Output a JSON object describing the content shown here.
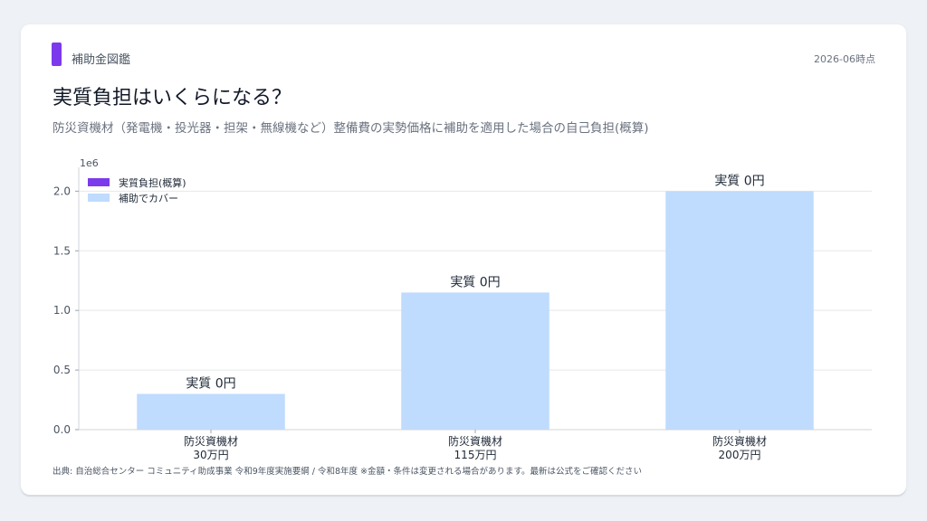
{
  "header": {
    "brand": "補助金図鑑",
    "date": "2026-06時点"
  },
  "title": "実質負担はいくらになる？",
  "subtitle": "防災資機材（発電機・投光器・担架・無線機など）整備費の実勢価格に補助を適用した場合の自己負担(概算)",
  "footnote": "出典: 自治総合センター コミュニティ助成事業 令和9年度実施要綱 / 令和8年度 ※金額・条件は変更される場合があります。最新は公式をご確認ください",
  "colors": {
    "accent": "#7c3aed",
    "self_burden": "#7c3aed",
    "covered": "#bfdbfe"
  },
  "chart_data": {
    "type": "bar",
    "stacked": true,
    "categories": [
      [
        "防災資機材",
        "30万円"
      ],
      [
        "防災資機材",
        "115万円"
      ],
      [
        "防災資機材",
        "200万円"
      ]
    ],
    "series": [
      {
        "name": "実質負担(概算)",
        "values": [
          0,
          0,
          0
        ],
        "color": "#7c3aed"
      },
      {
        "name": "補助でカバー",
        "values": [
          300000,
          1150000,
          2000000
        ],
        "color": "#bfdbfe"
      }
    ],
    "data_labels": [
      "実質 0円",
      "実質 0円",
      "実質 0円"
    ],
    "ylim": [
      0,
      2200000
    ],
    "yticks": [
      0,
      500000,
      1000000,
      1500000,
      2000000
    ],
    "ytick_labels": [
      "0.0",
      "0.5",
      "1.0",
      "1.5",
      "2.0"
    ],
    "y_exponent_label": "1e6",
    "grid": true,
    "legend": "top-left"
  }
}
